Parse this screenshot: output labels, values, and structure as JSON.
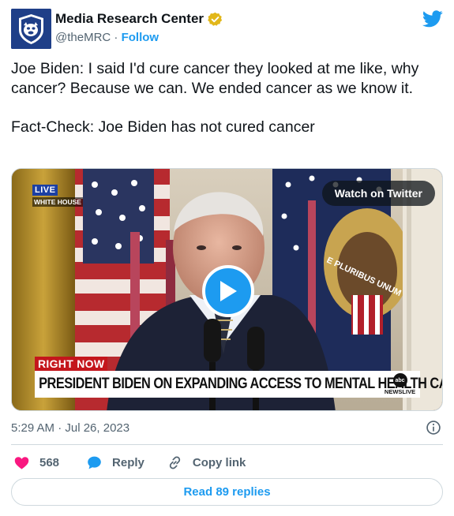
{
  "author": {
    "name": "Media Research Center",
    "handle": "@theMRC",
    "separator": "·",
    "follow_label": "Follow"
  },
  "tweet": {
    "line1": "Joe Biden: I said I'd cure cancer they looked at me like, why cancer? Because we can. We ended cancer as we know it.",
    "line2": "Fact-Check: Joe Biden has not cured cancer"
  },
  "media": {
    "live_label": "LIVE",
    "location_label": "WHITE HOUSE",
    "watch_label": "Watch on Twitter",
    "banner_label": "RIGHT NOW",
    "headline": "PRESIDENT BIDEN ON EXPANDING ACCESS TO MENTAL HEALTH CARE",
    "network_logo": "abc",
    "network_label": "NEWSLIVE",
    "seal_text": "E PLURIBUS UNUM"
  },
  "timestamp": "5:29 AM · Jul 26, 2023",
  "actions": {
    "like_count": "568",
    "reply_label": "Reply",
    "copy_label": "Copy link"
  },
  "read_replies_label": "Read 89 replies",
  "colors": {
    "brand_blue": "#1d9bf0",
    "like_red": "#f91880",
    "text_secondary": "#536471",
    "border": "#cfd9de",
    "verified_gold": "#e2b719"
  },
  "icons": {
    "twitter": "twitter-bird-icon",
    "verified": "verified-badge-icon",
    "like": "heart-icon",
    "reply": "speech-bubble-icon",
    "copy": "link-icon",
    "info": "info-icon",
    "play": "play-icon"
  }
}
